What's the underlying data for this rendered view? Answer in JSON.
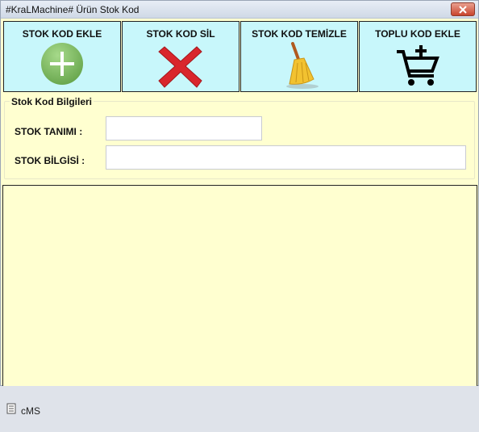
{
  "window": {
    "title": "#KraLMachine#  Ürün Stok Kod"
  },
  "toolbar": {
    "buttons": [
      {
        "label": "STOK KOD EKLE",
        "icon": "plus-circle-icon",
        "color": "#7cb85e"
      },
      {
        "label": "STOK KOD SİL",
        "icon": "red-x-icon",
        "color": "#d9262c"
      },
      {
        "label": "STOK KOD TEMİZLE",
        "icon": "broom-icon",
        "color": "#f2c230"
      },
      {
        "label": "TOPLU KOD EKLE",
        "icon": "cart-plus-icon",
        "color": "#000000"
      }
    ]
  },
  "form": {
    "group_title": "Stok Kod Bilgileri",
    "stok_tanimi_label": "STOK TANIMI :",
    "stok_tanimi_value": "",
    "stok_bilgisi_label": "STOK BİLGİSİ :",
    "stok_bilgisi_value": ""
  },
  "status": {
    "text": "cMS",
    "icon": "grip-icon"
  },
  "colors": {
    "form_background": "#ffffd0",
    "button_background": "#c8f7fb",
    "status_background": "#dfe3ea"
  }
}
